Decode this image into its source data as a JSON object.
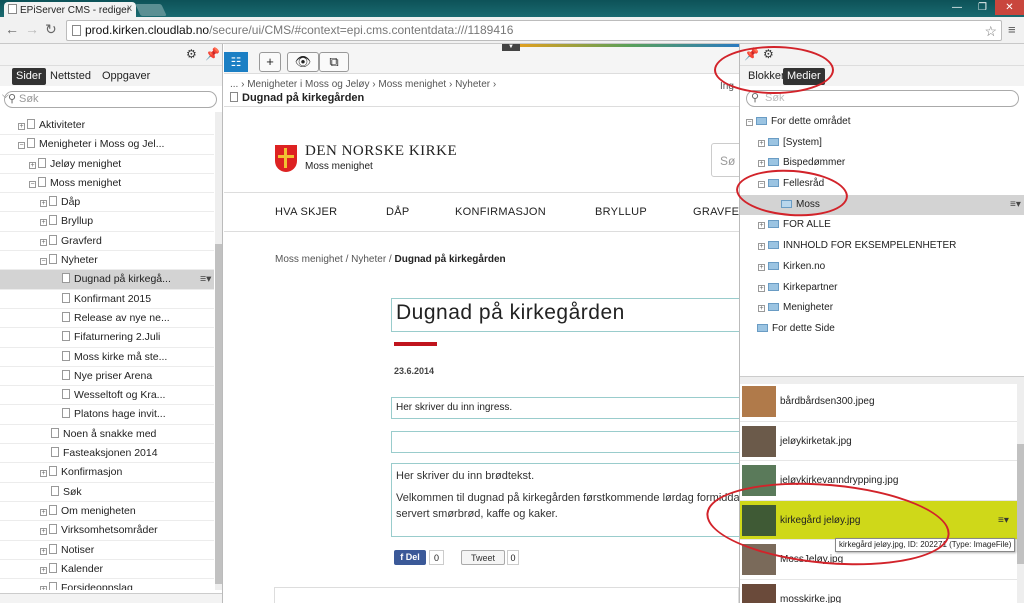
{
  "browser": {
    "tab_title": "EPiServer CMS - rediger",
    "close": "x",
    "url_host": "prod.kirken.cloudlab.no",
    "url_path": "/secure/ui/CMS/#context=epi.cms.contentdata:///1189416",
    "win": {
      "min": "—",
      "max": "❐",
      "close": "✕"
    }
  },
  "left_pane": {
    "tabs": [
      "Sider",
      "Nettsted",
      "Oppgaver"
    ],
    "search_placeholder": "Søk",
    "tree": [
      {
        "label": "Aktiviteter",
        "indent": 1,
        "exp": "+"
      },
      {
        "label": "Menigheter i Moss og Jel...",
        "indent": 1,
        "exp": "−"
      },
      {
        "label": "Jeløy menighet",
        "indent": 2,
        "exp": "+"
      },
      {
        "label": "Moss menighet",
        "indent": 2,
        "exp": "−"
      },
      {
        "label": "Dåp",
        "indent": 3,
        "exp": "+"
      },
      {
        "label": "Bryllup",
        "indent": 3,
        "exp": "+"
      },
      {
        "label": "Gravferd",
        "indent": 3,
        "exp": "+"
      },
      {
        "label": "Nyheter",
        "indent": 3,
        "exp": "−"
      },
      {
        "label": "Dugnad på kirkegå...",
        "indent": 4,
        "exp": "",
        "selected": true
      },
      {
        "label": "Konfirmant 2015",
        "indent": 4,
        "exp": ""
      },
      {
        "label": "Release av nye ne...",
        "indent": 4,
        "exp": ""
      },
      {
        "label": "Fifaturnering 2.Juli",
        "indent": 4,
        "exp": ""
      },
      {
        "label": "Moss kirke må ste...",
        "indent": 4,
        "exp": ""
      },
      {
        "label": "Nye priser Arena",
        "indent": 4,
        "exp": ""
      },
      {
        "label": "Wesseltoft og Kra...",
        "indent": 4,
        "exp": ""
      },
      {
        "label": "Platons hage invit...",
        "indent": 4,
        "exp": ""
      },
      {
        "label": "Noen å snakke med",
        "indent": 3,
        "exp": ""
      },
      {
        "label": "Fasteaksjonen 2014",
        "indent": 3,
        "exp": ""
      },
      {
        "label": "Konfirmasjon",
        "indent": 3,
        "exp": "+"
      },
      {
        "label": "Søk",
        "indent": 3,
        "exp": ""
      },
      {
        "label": "Om menigheten",
        "indent": 3,
        "exp": "+"
      },
      {
        "label": "Virksomhetsområder",
        "indent": 3,
        "exp": "+"
      },
      {
        "label": "Notiser",
        "indent": 3,
        "exp": "+"
      },
      {
        "label": "Kalender",
        "indent": 3,
        "exp": "+"
      },
      {
        "label": "Forsideoppslag",
        "indent": 3,
        "exp": "+"
      }
    ]
  },
  "toolbar": {
    "breadcrumb": "... › Menigheter i Moss og Jeløy › Moss menighet › Nyheter ›",
    "page_title": "Dugnad på kirkegården",
    "cut_text": "Ing"
  },
  "page": {
    "logo_name": "DEN NORSKE KIRKE",
    "logo_sub": "Moss menighet",
    "search_cut": "Sø",
    "nav": [
      "HVA SKJER",
      "DÅP",
      "KONFIRMASJON",
      "BRYLLUP",
      "GRAVFE"
    ],
    "crumb_path": "Moss menighet / Nyheter / ",
    "crumb_current": "Dugnad på kirkegården",
    "heading": "Dugnad på kirkegården",
    "date": "23.6.2014",
    "ingress": "Her skriver du inn ingress.",
    "body_1": "Her skriver du inn brødtekst.",
    "body_2": "Velkommen til dugnad på kirkegården førstkommende lørdag formidda",
    "body_3": "servert smørbrød, kaffe og kaker.",
    "fb_label": "Del",
    "fb_count": "0",
    "tw_label": "Tweet",
    "tw_count": "0"
  },
  "right_pane": {
    "tabs": [
      "Blokker",
      "Medier"
    ],
    "search_placeholder": "Søk",
    "folders": [
      {
        "label": "For dette området",
        "indent": 0,
        "exp": "−"
      },
      {
        "label": "[System]",
        "indent": 1,
        "exp": "+"
      },
      {
        "label": "Bispedømmer",
        "indent": 1,
        "exp": "+"
      },
      {
        "label": "Fellesråd",
        "indent": 1,
        "exp": "−"
      },
      {
        "label": "Moss",
        "indent": 2,
        "exp": "",
        "selected": true
      },
      {
        "label": "FOR ALLE",
        "indent": 1,
        "exp": "+"
      },
      {
        "label": "INNHOLD FOR EKSEMPELENHETER",
        "indent": 1,
        "exp": "+"
      },
      {
        "label": "Kirken.no",
        "indent": 1,
        "exp": "+"
      },
      {
        "label": "Kirkepartner",
        "indent": 1,
        "exp": "+"
      },
      {
        "label": "Menigheter",
        "indent": 1,
        "exp": "+"
      },
      {
        "label": "For dette Side",
        "indent": 0,
        "exp": ""
      }
    ],
    "media": [
      {
        "name": "bårdbårdsen300.jpeg",
        "thumb": "#b07a4a"
      },
      {
        "name": "jeløykirketak.jpg",
        "thumb": "#6b5a4a"
      },
      {
        "name": "jeløykirkevanndrypping.jpg",
        "thumb": "#5a7a5a"
      },
      {
        "name": "kirkegård jeløy.jpg",
        "thumb": "#3f5a35",
        "highlight": true
      },
      {
        "name": "MossJeløy.jpg",
        "thumb": "#7a6a5a"
      },
      {
        "name": "mosskirke.jpg",
        "thumb": "#6a4a3a"
      }
    ],
    "tooltip": "kirkegård jeløy.jpg, ID: 202271 (Type: ImageFile)"
  },
  "colors": {
    "accent": "#1b7fc4",
    "highlight": "#cfd819",
    "annotation": "#d2232a"
  }
}
